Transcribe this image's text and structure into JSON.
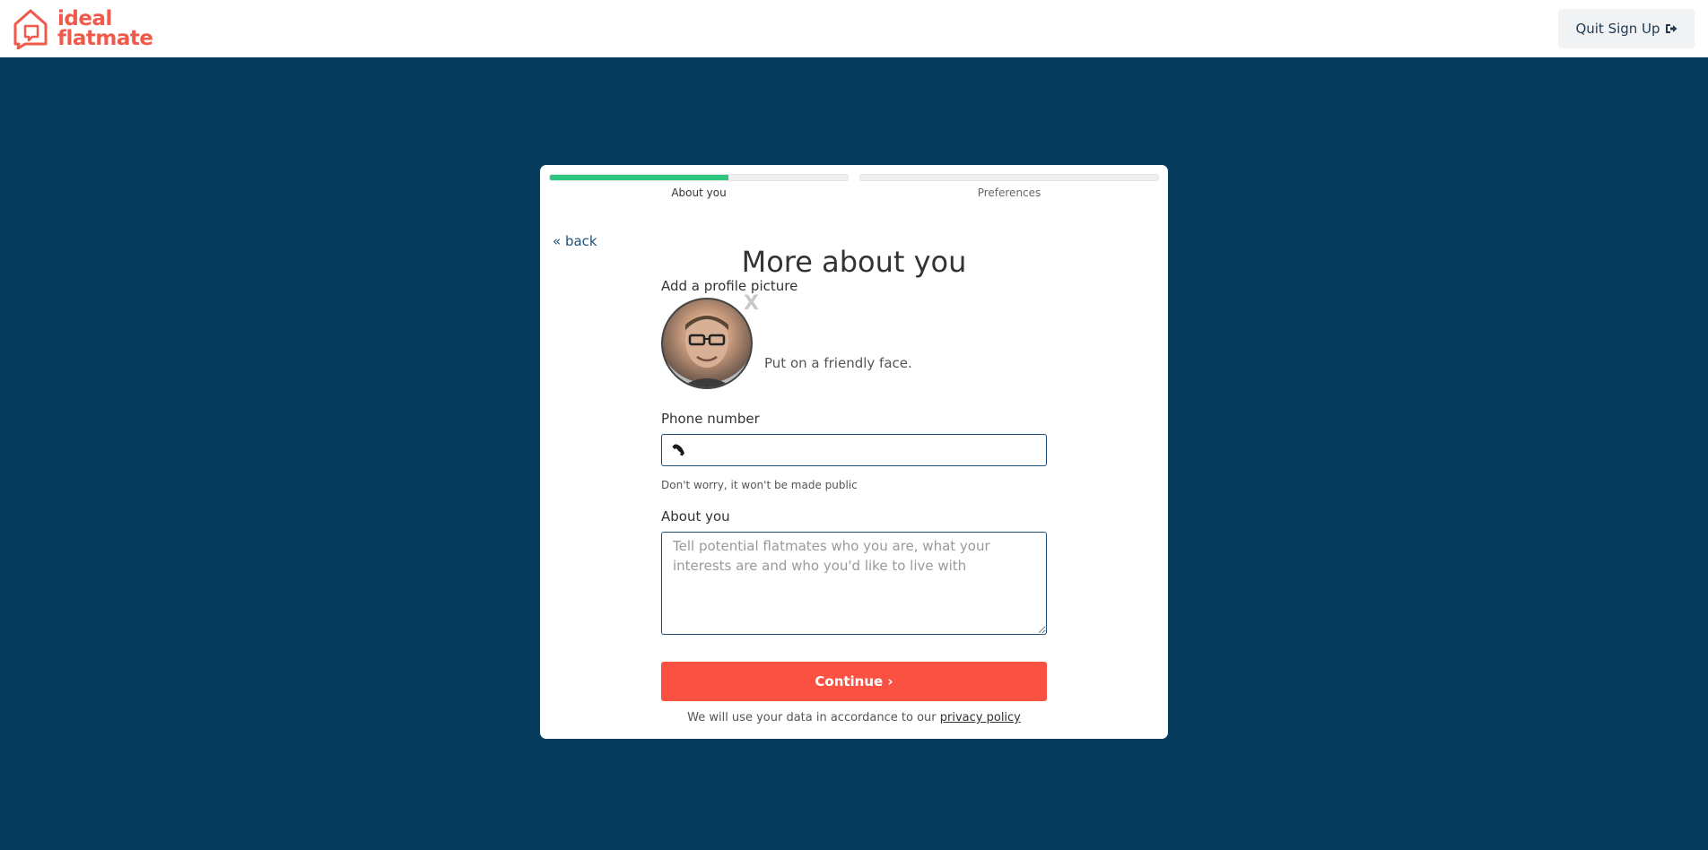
{
  "header": {
    "logo_line1": "ideal",
    "logo_line2": "flatmate",
    "quit_label": "Quit Sign Up",
    "brand_color": "#f05a4a"
  },
  "progress": {
    "steps": [
      {
        "label": "About you",
        "fill_fraction": 0.6
      },
      {
        "label": "Preferences",
        "fill_fraction": 0.0
      }
    ],
    "fill_color": "#2ec57d"
  },
  "page": {
    "back_label": "« back",
    "title": "More about you"
  },
  "profile_picture": {
    "label": "Add a profile picture",
    "remove_label": "X",
    "caption": "Put on a friendly face."
  },
  "phone": {
    "label": "Phone number",
    "value": "",
    "placeholder": "",
    "hint": "Don't worry, it won't be made public"
  },
  "about": {
    "label": "About you",
    "value": "",
    "placeholder": "Tell potential flatmates who you are, what your interests are and who you'd like to live with"
  },
  "continue_label": "Continue ›",
  "privacy": {
    "text": "We will use your data in accordance to our",
    "link_label": "privacy policy"
  },
  "colors": {
    "background": "#083c5d",
    "button": "#fa5142"
  }
}
